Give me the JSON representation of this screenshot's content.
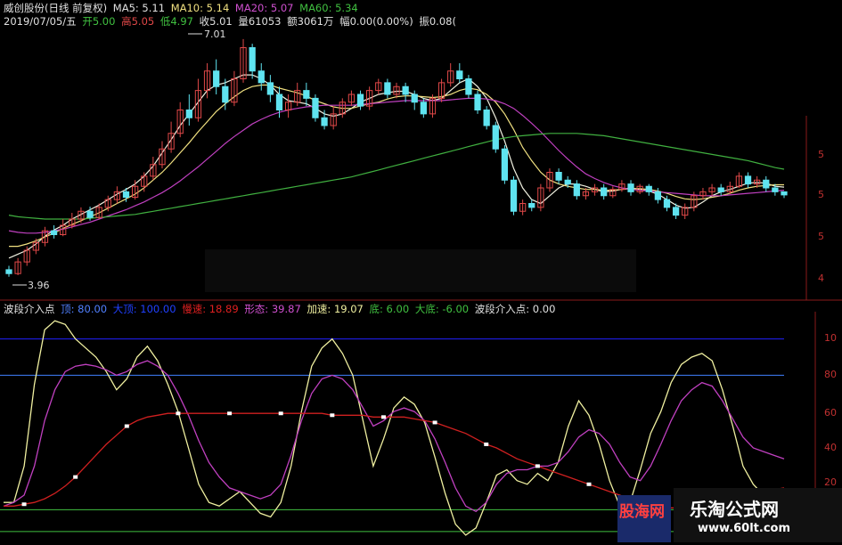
{
  "header": {
    "title": "威创股份(日线 前复权)",
    "ma5": "MA5: 5.11",
    "ma10": "MA10: 5.14",
    "ma20": "MA20: 5.07",
    "ma60": "MA60: 5.34",
    "date": "2019/07/05/五",
    "open": "开5.00",
    "high": "高5.05",
    "low": "低4.97",
    "close": "收5.01",
    "volume": "量61053",
    "amount": "额3061万",
    "change": "幅0.00(0.00%)",
    "amplitude": "振0.08("
  },
  "indicator_header": {
    "name": "波段介入点",
    "top": "顶: 80.00",
    "big_top": "大顶: 100.00",
    "slow": "慢速: 18.89",
    "shape": "形态: 39.87",
    "fast": "加速: 19.07",
    "bottom": "底: 6.00",
    "big_bottom": "大底: -6.00",
    "entry": "波段介入点: 0.00"
  },
  "annotations": {
    "high_label": "7.01",
    "low_label": "3.96"
  },
  "right_axis": {
    "price_ticks": [
      "5",
      "5",
      "5",
      "4"
    ],
    "indicator_ticks": [
      "10",
      "80",
      "60",
      "40",
      "20"
    ]
  },
  "watermarks": {
    "left": "股海网",
    "right_title": "乐淘公式网",
    "right_url": "www.60lt.com"
  },
  "colors": {
    "background": "#000000",
    "up_candle": "#e04848",
    "down_candle": "#5fe3f0",
    "ma5": "#f0f0e0",
    "ma10": "#f0e080",
    "ma20": "#c040c0",
    "ma60": "#40b040",
    "big_top_line": "#2020ff",
    "top_line": "#4080ff",
    "bottom_line": "#40c040",
    "big_bottom_line": "#40c040",
    "fast_line": "#f0f0a0",
    "shape_line": "#c040c0",
    "slow_line": "#d02020"
  },
  "chart_data": [
    {
      "type": "candlestick",
      "title": "威创股份(日线 前复权)",
      "ylim": [
        3.9,
        7.1
      ],
      "candles": [
        [
          4.05,
          4.0,
          4.1,
          3.96
        ],
        [
          4.0,
          4.15,
          4.2,
          3.98
        ],
        [
          4.15,
          4.3,
          4.35,
          4.1
        ],
        [
          4.3,
          4.4,
          4.45,
          4.25
        ],
        [
          4.4,
          4.55,
          4.6,
          4.35
        ],
        [
          4.55,
          4.5,
          4.62,
          4.45
        ],
        [
          4.5,
          4.62,
          4.7,
          4.48
        ],
        [
          4.62,
          4.7,
          4.78,
          4.58
        ],
        [
          4.7,
          4.8,
          4.85,
          4.65
        ],
        [
          4.8,
          4.72,
          4.86,
          4.68
        ],
        [
          4.72,
          4.85,
          4.9,
          4.7
        ],
        [
          4.85,
          4.95,
          5.0,
          4.8
        ],
        [
          4.95,
          5.05,
          5.12,
          4.9
        ],
        [
          5.05,
          4.98,
          5.1,
          4.92
        ],
        [
          4.98,
          5.12,
          5.2,
          4.95
        ],
        [
          5.12,
          5.25,
          5.3,
          5.05
        ],
        [
          5.25,
          5.4,
          5.5,
          5.2
        ],
        [
          5.4,
          5.6,
          5.7,
          5.35
        ],
        [
          5.6,
          5.8,
          5.95,
          5.55
        ],
        [
          5.8,
          6.1,
          6.2,
          5.75
        ],
        [
          6.1,
          6.0,
          6.3,
          5.9
        ],
        [
          6.0,
          6.35,
          6.5,
          5.95
        ],
        [
          6.35,
          6.6,
          6.7,
          6.25
        ],
        [
          6.6,
          6.4,
          6.75,
          6.3
        ],
        [
          6.4,
          6.2,
          6.5,
          6.1
        ],
        [
          6.2,
          6.5,
          6.6,
          6.15
        ],
        [
          6.5,
          6.9,
          7.01,
          6.45
        ],
        [
          6.9,
          6.6,
          6.95,
          6.5
        ],
        [
          6.6,
          6.45,
          6.7,
          6.35
        ],
        [
          6.45,
          6.3,
          6.55,
          6.2
        ],
        [
          6.3,
          6.1,
          6.4,
          6.0
        ],
        [
          6.1,
          6.2,
          6.3,
          6.0
        ],
        [
          6.2,
          6.35,
          6.45,
          6.15
        ],
        [
          6.35,
          6.25,
          6.45,
          6.15
        ],
        [
          6.25,
          6.0,
          6.3,
          5.95
        ],
        [
          6.0,
          5.9,
          6.1,
          5.85
        ],
        [
          5.9,
          6.05,
          6.15,
          5.85
        ],
        [
          6.05,
          6.2,
          6.25,
          6.0
        ],
        [
          6.2,
          6.3,
          6.35,
          6.15
        ],
        [
          6.3,
          6.15,
          6.35,
          6.1
        ],
        [
          6.15,
          6.35,
          6.4,
          6.1
        ],
        [
          6.35,
          6.45,
          6.5,
          6.3
        ],
        [
          6.45,
          6.3,
          6.5,
          6.25
        ],
        [
          6.3,
          6.4,
          6.45,
          6.25
        ],
        [
          6.4,
          6.3,
          6.45,
          6.2
        ],
        [
          6.3,
          6.2,
          6.35,
          6.1
        ],
        [
          6.2,
          6.05,
          6.25,
          6.0
        ],
        [
          6.05,
          6.25,
          6.3,
          6.0
        ],
        [
          6.25,
          6.45,
          6.5,
          6.2
        ],
        [
          6.45,
          6.6,
          6.7,
          6.4
        ],
        [
          6.6,
          6.5,
          6.7,
          6.45
        ],
        [
          6.5,
          6.3,
          6.55,
          6.25
        ],
        [
          6.3,
          6.1,
          6.35,
          6.05
        ],
        [
          6.1,
          5.9,
          6.15,
          5.85
        ],
        [
          5.9,
          5.6,
          5.95,
          5.55
        ],
        [
          5.6,
          5.2,
          5.65,
          5.15
        ],
        [
          5.2,
          4.8,
          5.25,
          4.75
        ],
        [
          4.8,
          4.9,
          4.95,
          4.75
        ],
        [
          4.9,
          4.85,
          4.95,
          4.8
        ],
        [
          4.85,
          5.1,
          5.15,
          4.8
        ],
        [
          5.1,
          5.3,
          5.35,
          5.05
        ],
        [
          5.3,
          5.2,
          5.35,
          5.15
        ],
        [
          5.2,
          5.15,
          5.25,
          5.1
        ],
        [
          5.15,
          5.0,
          5.2,
          4.95
        ],
        [
          5.0,
          5.05,
          5.1,
          4.95
        ],
        [
          5.05,
          5.1,
          5.15,
          5.0
        ],
        [
          5.1,
          5.0,
          5.15,
          4.95
        ],
        [
          5.0,
          5.08,
          5.12,
          4.97
        ],
        [
          5.08,
          5.15,
          5.2,
          5.05
        ],
        [
          5.15,
          5.05,
          5.2,
          5.0
        ],
        [
          5.05,
          5.12,
          5.15,
          5.02
        ],
        [
          5.12,
          5.05,
          5.15,
          5.0
        ],
        [
          5.05,
          4.95,
          5.1,
          4.9
        ],
        [
          4.95,
          4.85,
          5.0,
          4.8
        ],
        [
          4.85,
          4.75,
          4.9,
          4.7
        ],
        [
          4.75,
          4.85,
          4.9,
          4.7
        ],
        [
          4.85,
          5.0,
          5.05,
          4.8
        ],
        [
          5.0,
          5.05,
          5.1,
          4.95
        ],
        [
          5.05,
          5.1,
          5.15,
          5.0
        ],
        [
          5.1,
          5.05,
          5.15,
          5.0
        ],
        [
          5.05,
          5.12,
          5.18,
          5.02
        ],
        [
          5.12,
          5.25,
          5.3,
          5.1
        ],
        [
          5.25,
          5.15,
          5.3,
          5.1
        ],
        [
          5.15,
          5.2,
          5.25,
          5.1
        ],
        [
          5.2,
          5.1,
          5.25,
          5.05
        ],
        [
          5.1,
          5.05,
          5.15,
          5.0
        ],
        [
          5.05,
          5.01,
          5.05,
          4.97
        ]
      ],
      "series": [
        {
          "name": "MA5",
          "values": [
            4.2,
            4.25,
            4.3,
            4.38,
            4.48,
            4.56,
            4.62,
            4.7,
            4.76,
            4.82,
            4.88,
            4.95,
            5.02,
            5.08,
            5.15,
            5.25,
            5.38,
            5.55,
            5.72,
            5.9,
            6.05,
            6.2,
            6.35,
            6.42,
            6.45,
            6.5,
            6.55,
            6.55,
            6.5,
            6.42,
            6.3,
            6.22,
            6.2,
            6.18,
            6.12,
            6.05,
            6.02,
            6.05,
            6.12,
            6.2,
            6.25,
            6.3,
            6.32,
            6.34,
            6.34,
            6.3,
            6.25,
            6.22,
            6.25,
            6.35,
            6.45,
            6.5,
            6.4,
            6.25,
            6.0,
            5.7,
            5.35,
            5.1,
            4.95,
            4.9,
            5.0,
            5.1,
            5.15,
            5.15,
            5.12,
            5.08,
            5.05,
            5.06,
            5.08,
            5.1,
            5.08,
            5.06,
            5.02,
            4.95,
            4.88,
            4.84,
            4.85,
            4.92,
            5.0,
            5.05,
            5.08,
            5.12,
            5.16,
            5.17,
            5.16,
            5.12,
            5.11
          ]
        },
        {
          "name": "MA10",
          "values": [
            4.35,
            4.35,
            4.38,
            4.42,
            4.47,
            4.52,
            4.58,
            4.63,
            4.68,
            4.73,
            4.78,
            4.84,
            4.9,
            4.96,
            5.02,
            5.1,
            5.2,
            5.3,
            5.42,
            5.55,
            5.68,
            5.82,
            5.95,
            6.08,
            6.18,
            6.27,
            6.35,
            6.4,
            6.42,
            6.42,
            6.38,
            6.35,
            6.32,
            6.28,
            6.22,
            6.18,
            6.14,
            6.12,
            6.12,
            6.15,
            6.18,
            6.2,
            6.24,
            6.27,
            6.28,
            6.28,
            6.27,
            6.26,
            6.27,
            6.3,
            6.35,
            6.38,
            6.36,
            6.3,
            6.2,
            6.05,
            5.85,
            5.62,
            5.45,
            5.3,
            5.2,
            5.15,
            5.12,
            5.1,
            5.08,
            5.08,
            5.07,
            5.07,
            5.08,
            5.09,
            5.09,
            5.08,
            5.06,
            5.03,
            4.99,
            4.96,
            4.95,
            4.96,
            4.98,
            5.0,
            5.03,
            5.07,
            5.1,
            5.12,
            5.13,
            5.14,
            5.14
          ]
        },
        {
          "name": "MA20",
          "values": [
            4.55,
            4.53,
            4.52,
            4.52,
            4.53,
            4.55,
            4.57,
            4.6,
            4.63,
            4.66,
            4.7,
            4.74,
            4.78,
            4.82,
            4.87,
            4.92,
            4.98,
            5.04,
            5.11,
            5.19,
            5.28,
            5.37,
            5.47,
            5.57,
            5.67,
            5.76,
            5.84,
            5.92,
            5.98,
            6.03,
            6.07,
            6.1,
            6.12,
            6.14,
            6.15,
            6.16,
            6.16,
            6.16,
            6.16,
            6.17,
            6.18,
            6.19,
            6.2,
            6.21,
            6.22,
            6.22,
            6.22,
            6.22,
            6.22,
            6.23,
            6.24,
            6.25,
            6.25,
            6.24,
            6.22,
            6.18,
            6.12,
            6.03,
            5.93,
            5.82,
            5.7,
            5.58,
            5.47,
            5.37,
            5.28,
            5.22,
            5.17,
            5.13,
            5.1,
            5.08,
            5.07,
            5.06,
            5.05,
            5.04,
            5.03,
            5.02,
            5.01,
            5.0,
            5.0,
            5.0,
            5.01,
            5.02,
            5.03,
            5.04,
            5.05,
            5.06,
            5.07
          ]
        },
        {
          "name": "MA60",
          "values": [
            4.75,
            4.73,
            4.72,
            4.71,
            4.7,
            4.7,
            4.7,
            4.7,
            4.7,
            4.71,
            4.72,
            4.73,
            4.74,
            4.75,
            4.76,
            4.78,
            4.8,
            4.82,
            4.84,
            4.86,
            4.88,
            4.9,
            4.92,
            4.94,
            4.96,
            4.98,
            5.0,
            5.02,
            5.04,
            5.06,
            5.08,
            5.1,
            5.12,
            5.14,
            5.16,
            5.18,
            5.2,
            5.22,
            5.24,
            5.27,
            5.3,
            5.33,
            5.36,
            5.39,
            5.42,
            5.45,
            5.48,
            5.51,
            5.54,
            5.57,
            5.6,
            5.63,
            5.66,
            5.69,
            5.72,
            5.74,
            5.76,
            5.77,
            5.78,
            5.79,
            5.8,
            5.8,
            5.8,
            5.8,
            5.79,
            5.78,
            5.77,
            5.75,
            5.73,
            5.71,
            5.69,
            5.67,
            5.65,
            5.63,
            5.61,
            5.59,
            5.57,
            5.55,
            5.53,
            5.51,
            5.49,
            5.47,
            5.45,
            5.42,
            5.39,
            5.36,
            5.34
          ]
        }
      ]
    },
    {
      "type": "line",
      "title": "波段介入点",
      "ylim": [
        -10,
        115
      ],
      "hlines": [
        {
          "name": "大顶",
          "value": 100
        },
        {
          "name": "顶",
          "value": 80
        },
        {
          "name": "底",
          "value": 6
        },
        {
          "name": "大底",
          "value": -6
        }
      ],
      "series": [
        {
          "name": "加速",
          "values": [
            10,
            10,
            30,
            75,
            105,
            110,
            108,
            100,
            95,
            90,
            82,
            72,
            78,
            90,
            96,
            88,
            75,
            60,
            40,
            20,
            10,
            8,
            12,
            16,
            10,
            4,
            2,
            10,
            30,
            60,
            85,
            95,
            100,
            92,
            80,
            55,
            30,
            45,
            62,
            68,
            64,
            54,
            35,
            15,
            -2,
            -8,
            -4,
            10,
            25,
            28,
            22,
            20,
            26,
            22,
            32,
            52,
            66,
            58,
            42,
            22,
            8,
            10,
            28,
            48,
            60,
            76,
            86,
            90,
            92,
            88,
            72,
            52,
            30,
            20,
            14,
            12,
            8
          ]
        },
        {
          "name": "形态",
          "values": [
            8,
            10,
            14,
            30,
            55,
            72,
            82,
            85,
            86,
            85,
            83,
            80,
            82,
            86,
            88,
            85,
            80,
            70,
            58,
            44,
            32,
            24,
            18,
            16,
            14,
            12,
            14,
            20,
            36,
            55,
            70,
            78,
            80,
            78,
            72,
            62,
            52,
            55,
            60,
            62,
            60,
            55,
            45,
            32,
            18,
            8,
            5,
            10,
            20,
            26,
            28,
            28,
            30,
            30,
            32,
            38,
            46,
            50,
            48,
            42,
            32,
            24,
            22,
            30,
            42,
            55,
            66,
            72,
            76,
            74,
            66,
            56,
            46,
            40,
            38,
            36,
            34
          ]
        },
        {
          "name": "慢速",
          "values": [
            8,
            8,
            9,
            10,
            12,
            15,
            19,
            24,
            30,
            36,
            42,
            47,
            52,
            55,
            57,
            58,
            59,
            59,
            59,
            59,
            59,
            59,
            59,
            59,
            59,
            59,
            59,
            59,
            59,
            59,
            59,
            59,
            58,
            58,
            58,
            58,
            57,
            57,
            57,
            57,
            56,
            55,
            54,
            52,
            50,
            48,
            45,
            42,
            40,
            37,
            34,
            32,
            30,
            28,
            26,
            24,
            22,
            20,
            18,
            16,
            14,
            12,
            10,
            9,
            8,
            7,
            7,
            8,
            8,
            9,
            10,
            12,
            14,
            15,
            16,
            17,
            18
          ]
        }
      ]
    }
  ]
}
